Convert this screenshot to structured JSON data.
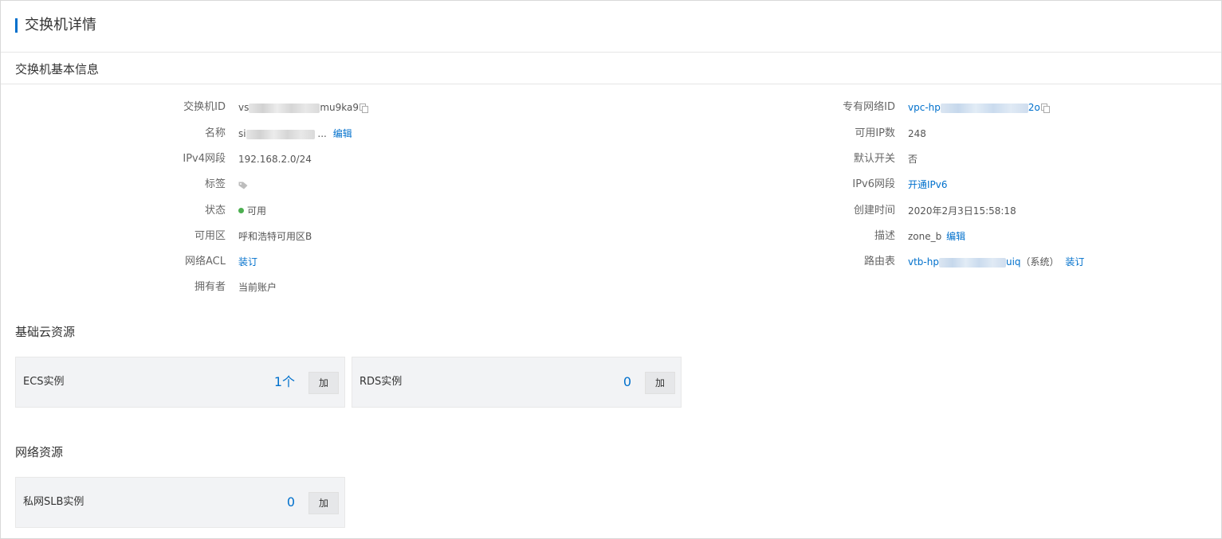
{
  "header": {
    "title": "交换机详情",
    "accent_color": "#0070cc"
  },
  "basic": {
    "title": "交换机基本信息",
    "left": {
      "switch_id": {
        "label": "交换机ID",
        "value_prefix": "vs",
        "value_suffix": "mu9ka9"
      },
      "name": {
        "label": "名称",
        "value_prefix": "si",
        "value_ellipsis": "...",
        "action": "编辑"
      },
      "ipv4": {
        "label": "IPv4网段",
        "value": "192.168.2.0/24"
      },
      "tags": {
        "label": "标签",
        "icon": "tag-icon"
      },
      "status": {
        "label": "状态",
        "value": "可用",
        "status_color": "#4caf50"
      },
      "zone": {
        "label": "可用区",
        "value": "呼和浩特可用区B"
      },
      "acl": {
        "label": "网络ACL",
        "action": "装订"
      },
      "owner": {
        "label": "拥有者",
        "value": "当前账户"
      }
    },
    "right": {
      "vpc_id": {
        "label": "专有网络ID",
        "value_prefix": "vpc-hp",
        "value_suffix": "2o"
      },
      "available_ips": {
        "label": "可用IP数",
        "value": "248"
      },
      "default_switch": {
        "label": "默认开关",
        "value": "否"
      },
      "ipv6": {
        "label": "IPv6网段",
        "action": "开通IPv6"
      },
      "created": {
        "label": "创建时间",
        "value": "2020年2月3日15:58:18"
      },
      "description": {
        "label": "描述",
        "value": "zone_b",
        "action": "编辑"
      },
      "route_table": {
        "label": "路由表",
        "value_prefix": "vtb-hp",
        "value_suffix": "uiq",
        "value_note": "（系统）",
        "action": "装订"
      }
    }
  },
  "cloud_resources": {
    "title": "基础云资源",
    "items": [
      {
        "label": "ECS实例",
        "count": "1个",
        "button": "加"
      },
      {
        "label": "RDS实例",
        "count": "0",
        "button": "加"
      }
    ]
  },
  "network_resources": {
    "title": "网络资源",
    "items": [
      {
        "label": "私网SLB实例",
        "count": "0",
        "button": "加"
      }
    ]
  }
}
